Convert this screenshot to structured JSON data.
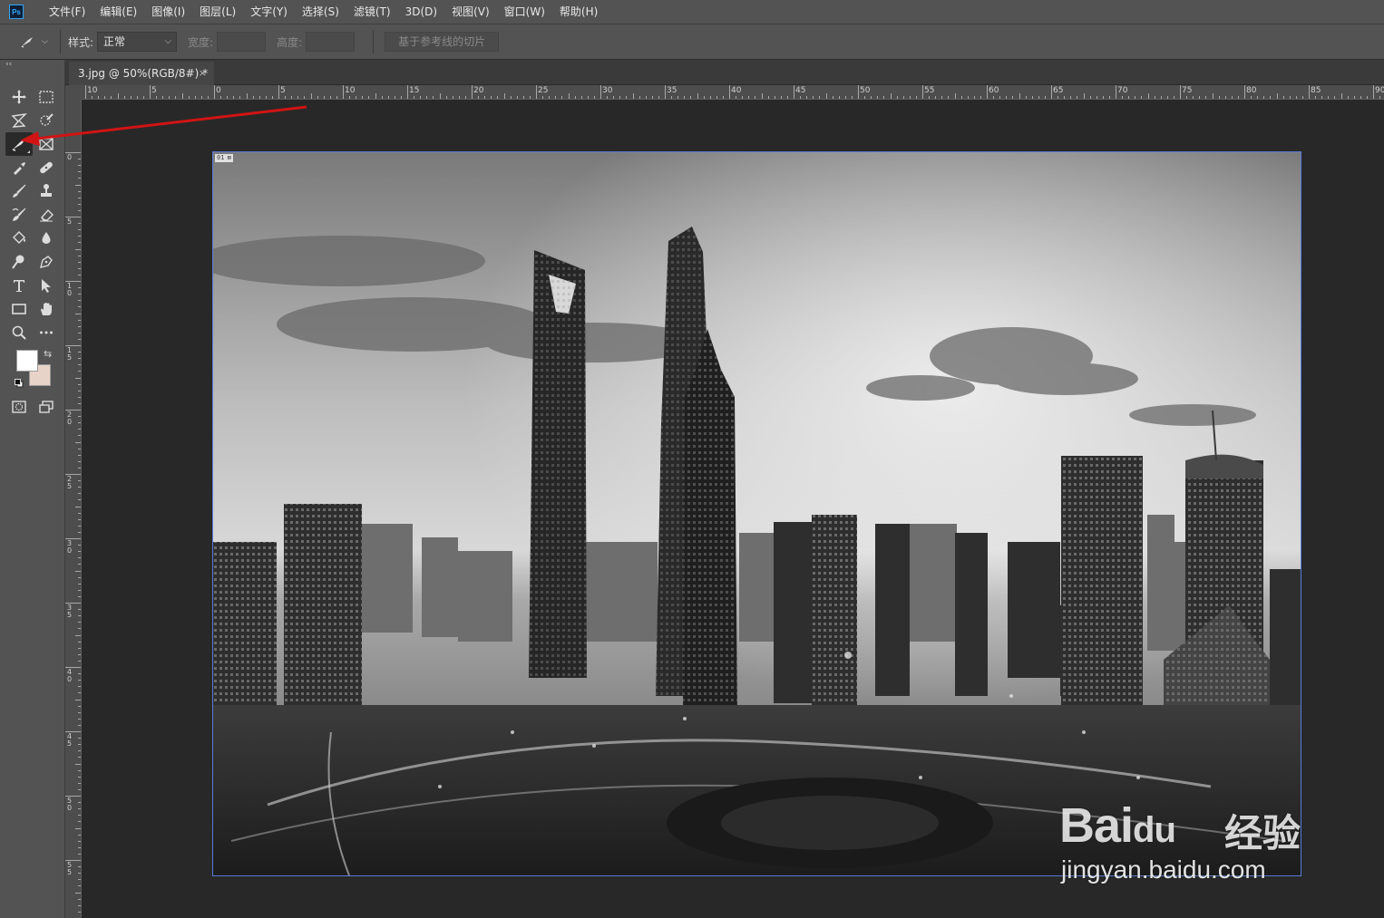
{
  "app": {
    "logo_text": "Ps"
  },
  "menu": [
    "文件(F)",
    "编辑(E)",
    "图像(I)",
    "图层(L)",
    "文字(Y)",
    "选择(S)",
    "滤镜(T)",
    "3D(D)",
    "视图(V)",
    "窗口(W)",
    "帮助(H)"
  ],
  "options": {
    "tool_icon": "slice-icon",
    "style_label": "样式:",
    "style_value": "正常",
    "width_label": "宽度:",
    "width_value": "",
    "height_label": "高度:",
    "height_value": "",
    "guides_button": "基于参考线的切片"
  },
  "toolbox": {
    "collapse": "‹‹",
    "swap": "⇆",
    "foreground_color": "#ffffff",
    "background_color": "#e8d3c9",
    "tools": [
      "move-icon",
      "rect-marquee-icon",
      "lasso-icon",
      "quick-selection-icon",
      "slice-icon",
      "frame-icon",
      "eyedropper-icon",
      "healing-brush-icon",
      "brush-icon",
      "clone-stamp-icon",
      "history-brush-icon",
      "eraser-icon",
      "paint-bucket-icon",
      "blur-drop-icon",
      "dodge-icon",
      "pen-icon",
      "type-icon",
      "path-selection-icon",
      "rectangle-icon",
      "hand-icon",
      "zoom-icon",
      "more-tools-icon"
    ],
    "active_tool": "slice-icon"
  },
  "document": {
    "tab_title": "3.jpg @ 50%(RGB/8#) *",
    "close": "×",
    "slice_number": "01"
  },
  "rulers": {
    "top_labels": [
      "10",
      "5",
      "0",
      "5",
      "10",
      "15",
      "20",
      "25",
      "30",
      "35",
      "40",
      "45",
      "50",
      "55",
      "60",
      "65",
      "70",
      "75",
      "80",
      "85",
      "90"
    ],
    "left_labels": [
      "0",
      "5",
      "10",
      "15",
      "20",
      "25",
      "30",
      "35",
      "40",
      "45",
      "50",
      "55"
    ]
  },
  "watermark": {
    "logo": "Bai",
    "paw": "du",
    "cn": "经验",
    "url": "jingyan.baidu.com"
  },
  "colors": {
    "accent_arrow": "#d01414",
    "slice_border": "#5a7bd6"
  }
}
